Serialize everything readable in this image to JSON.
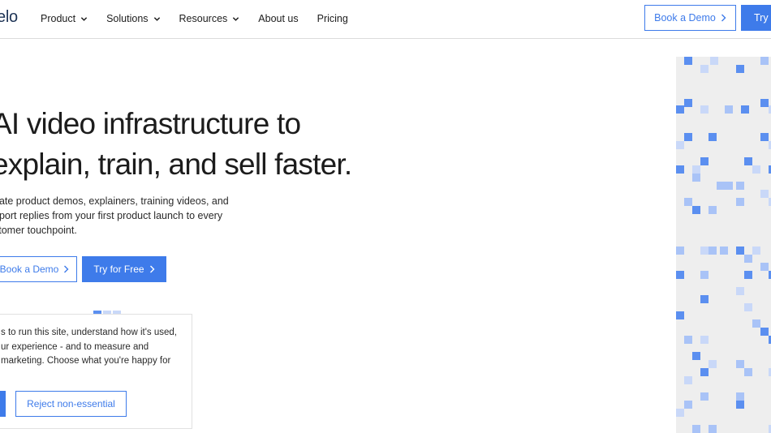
{
  "header": {
    "logo": "elo",
    "nav": [
      {
        "label": "Product",
        "dropdown": true
      },
      {
        "label": "Solutions",
        "dropdown": true
      },
      {
        "label": "Resources",
        "dropdown": true
      },
      {
        "label": "About us",
        "dropdown": false
      },
      {
        "label": "Pricing",
        "dropdown": false
      }
    ],
    "book_demo_label": "Book a Demo",
    "try_label": "Try f"
  },
  "hero": {
    "title_line1": "AI video infrastructure to",
    "title_line2": "explain, train, and sell faster.",
    "subtitle_line1": "eate product demos, explainers, training videos, and",
    "subtitle_line2": "pport replies from your first product launch to every",
    "subtitle_line3": "stomer touchpoint.",
    "book_demo_label": "Book a Demo",
    "try_free_label": "Try for Free"
  },
  "cookie": {
    "line1": "s to run this site, understand how it's used,",
    "line2": "ur experience - and to measure and",
    "line3": "marketing. Choose what you're happy for",
    "reject_label": "Reject non-essential"
  },
  "colors": {
    "accent": "#3e7bea",
    "logo": "#1e3456",
    "text": "#1c1c1c",
    "pixel_strong": "#5b8ff0",
    "pixel_mid": "#a9c3f7",
    "pixel_light": "#c9d8f8",
    "panel_bg": "#eeeeee"
  },
  "icons": {
    "nav_dropdown": "chevron-down-icon",
    "button_arrow": "chevron-right-icon"
  }
}
